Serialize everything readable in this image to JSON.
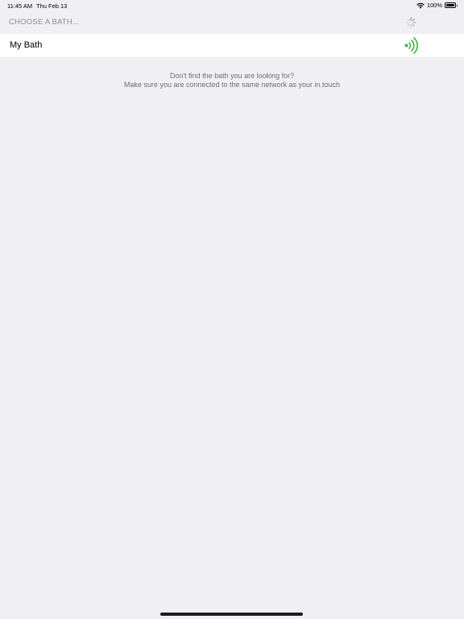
{
  "status_bar": {
    "time": "11:45 AM",
    "date": "Thu Feb 13",
    "battery_percent": "100%",
    "battery_level": 1.0,
    "wifi_icon": "wifi-icon",
    "battery_icon": "battery-icon"
  },
  "header": {
    "title": "CHOOSE A BATH...",
    "loading_icon": "activity-spinner-icon"
  },
  "baths": [
    {
      "name": "My Bath",
      "status_icon": "signal-connected-icon",
      "status_color": "#3cb43c"
    }
  ],
  "hint": {
    "line1": "Don't find the bath you are looking for?",
    "line2": "Make sure you are connected to the same network as your in.touch"
  },
  "colors": {
    "background": "#efeff4",
    "row_background": "#ffffff",
    "header_text": "#8a8a8e",
    "hint_text": "#6d6d72"
  }
}
